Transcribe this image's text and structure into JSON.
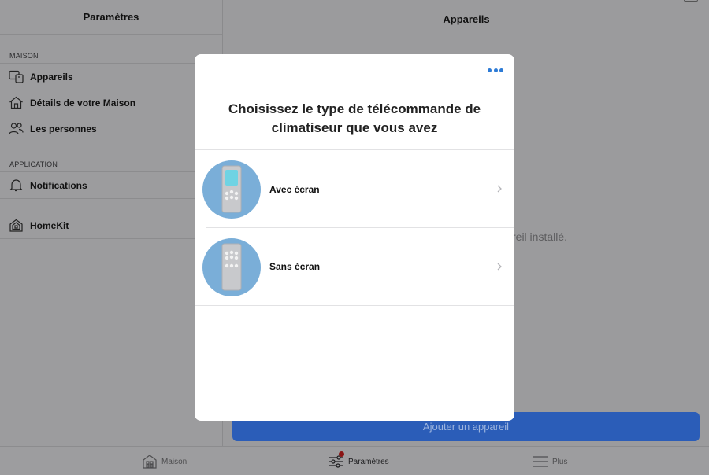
{
  "sidebar": {
    "title": "Paramètres",
    "section_home": "MAISON",
    "items_home": [
      {
        "label": "Appareils",
        "icon": "devices-icon"
      },
      {
        "label": "Détails de votre Maison",
        "icon": "house-icon"
      },
      {
        "label": "Les personnes",
        "icon": "people-icon"
      }
    ],
    "section_app": "APPLICATION",
    "item_notifications": {
      "label": "Notifications",
      "icon": "bell-icon"
    },
    "item_homekit": {
      "label": "HomeKit",
      "icon": "homekit-icon"
    }
  },
  "main": {
    "title": "Appareils",
    "empty_text_fragment": "reil installé.",
    "add_button": "Ajouter un appareil"
  },
  "tabbar": {
    "tabs": [
      {
        "label": "Maison",
        "icon": "home-icon"
      },
      {
        "label": "Paramètres",
        "icon": "sliders-icon",
        "badge": true
      },
      {
        "label": "Plus",
        "icon": "menu-icon"
      }
    ]
  },
  "modal": {
    "title": "Choisissez le type de télécommande de climatiseur que vous avez",
    "options": [
      {
        "label": "Avec écran",
        "icon": "remote-with-screen-icon"
      },
      {
        "label": "Sans écran",
        "icon": "remote-without-screen-icon"
      }
    ]
  },
  "colors": {
    "accent": "#2d7bd6",
    "button_bg": "#2b5db8",
    "badge": "#8a1414",
    "remote_circle": "#7aaed8"
  }
}
